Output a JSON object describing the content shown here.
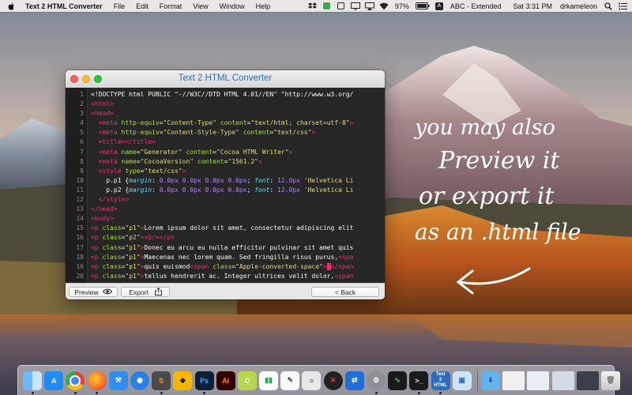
{
  "menubar": {
    "app_name": "Text 2 HTML Converter",
    "menus": [
      "File",
      "Edit",
      "Format",
      "View",
      "Window",
      "Help"
    ],
    "battery": "97%",
    "keyboard_layout": "ABC - Extended",
    "clock": "Sat 3:31 PM",
    "user": "drkameleon",
    "icons": [
      "apple-icon",
      "dropbox-icon",
      "green-status-icon",
      "box-icon",
      "display-icon",
      "airplay-icon",
      "wifi-icon",
      "battery-icon",
      "keyboard-icon",
      "search-icon",
      "notification-center-icon"
    ]
  },
  "window": {
    "title": "Text 2 HTML Converter",
    "line_numbers": [
      "1",
      "2",
      "3",
      "4",
      "5",
      "6",
      "7",
      "8",
      "9",
      "10",
      "11",
      "12",
      "13",
      "14",
      "15",
      "16",
      "17",
      "18",
      "19",
      "20"
    ],
    "code_lines": [
      [
        [
          "t-txt",
          "<!DOCTYPE html PUBLIC \"-//W3C//DTD HTML 4.01//EN\" \"http://www.w3.org/"
        ]
      ],
      [
        [
          "t-tag",
          "<html>"
        ]
      ],
      [
        [
          "t-tag",
          "<head>"
        ]
      ],
      [
        [
          "t-txt",
          "  "
        ],
        [
          "t-tag",
          "<meta "
        ],
        [
          "t-att",
          "http-equiv"
        ],
        [
          "t-txt",
          "="
        ],
        [
          "t-str",
          "\"Content-Type\""
        ],
        [
          "t-txt",
          " "
        ],
        [
          "t-att",
          "content"
        ],
        [
          "t-txt",
          "="
        ],
        [
          "t-str",
          "\"text/html; charset=utf-8\""
        ],
        [
          "t-tag",
          ">"
        ]
      ],
      [
        [
          "t-txt",
          "  "
        ],
        [
          "t-tag",
          "<meta "
        ],
        [
          "t-att",
          "http-equiv"
        ],
        [
          "t-txt",
          "="
        ],
        [
          "t-str",
          "\"Content-Style-Type\""
        ],
        [
          "t-txt",
          " "
        ],
        [
          "t-att",
          "content"
        ],
        [
          "t-txt",
          "="
        ],
        [
          "t-str",
          "\"text/css\""
        ],
        [
          "t-tag",
          ">"
        ]
      ],
      [
        [
          "t-txt",
          "  "
        ],
        [
          "t-tag",
          "<title></title>"
        ]
      ],
      [
        [
          "t-txt",
          "  "
        ],
        [
          "t-tag",
          "<meta "
        ],
        [
          "t-att",
          "name"
        ],
        [
          "t-txt",
          "="
        ],
        [
          "t-str",
          "\"Generator\""
        ],
        [
          "t-txt",
          " "
        ],
        [
          "t-att",
          "content"
        ],
        [
          "t-txt",
          "="
        ],
        [
          "t-str",
          "\"Cocoa HTML Writer\""
        ],
        [
          "t-tag",
          ">"
        ]
      ],
      [
        [
          "t-txt",
          "  "
        ],
        [
          "t-tag",
          "<meta "
        ],
        [
          "t-att",
          "name"
        ],
        [
          "t-txt",
          "="
        ],
        [
          "t-str",
          "\"CocoaVersion\""
        ],
        [
          "t-txt",
          " "
        ],
        [
          "t-att",
          "content"
        ],
        [
          "t-txt",
          "="
        ],
        [
          "t-str",
          "\"1561.2\""
        ],
        [
          "t-tag",
          ">"
        ]
      ],
      [
        [
          "t-txt",
          "  "
        ],
        [
          "t-tag",
          "<style "
        ],
        [
          "t-att",
          "type"
        ],
        [
          "t-txt",
          "="
        ],
        [
          "t-str",
          "\"text/css\""
        ],
        [
          "t-tag",
          ">"
        ]
      ],
      [
        [
          "t-txt",
          "    p.p1 {"
        ],
        [
          "t-key",
          "margin"
        ],
        [
          "t-txt",
          ": "
        ],
        [
          "t-num",
          "0.0px 0.0px 0.0px 0.0px"
        ],
        [
          "t-txt",
          "; "
        ],
        [
          "t-key",
          "font"
        ],
        [
          "t-txt",
          ": "
        ],
        [
          "t-num",
          "12.0px"
        ],
        [
          "t-str",
          " 'Helvetica Li"
        ]
      ],
      [
        [
          "t-txt",
          "    p.p2 {"
        ],
        [
          "t-key",
          "margin"
        ],
        [
          "t-txt",
          ": "
        ],
        [
          "t-num",
          "0.0px 0.0px 0.0px 0.0px"
        ],
        [
          "t-txt",
          "; "
        ],
        [
          "t-key",
          "font"
        ],
        [
          "t-txt",
          ": "
        ],
        [
          "t-num",
          "12.0px"
        ],
        [
          "t-str",
          " 'Helvetica Li"
        ]
      ],
      [
        [
          "t-txt",
          "  "
        ],
        [
          "t-tag",
          "</style>"
        ]
      ],
      [
        [
          "t-tag",
          "</head>"
        ]
      ],
      [
        [
          "t-tag",
          "<body>"
        ]
      ],
      [
        [
          "t-tag",
          "<p "
        ],
        [
          "t-att",
          "class"
        ],
        [
          "t-txt",
          "="
        ],
        [
          "t-str",
          "\"p1\""
        ],
        [
          "t-tag",
          ">"
        ],
        [
          "t-txt",
          "Lorem ipsum dolor sit amet, consectetur adipiscing elit"
        ]
      ],
      [
        [
          "t-tag",
          "<p "
        ],
        [
          "t-att",
          "class"
        ],
        [
          "t-txt",
          "="
        ],
        [
          "t-str",
          "\"p2\""
        ],
        [
          "t-tag",
          "><br></p>"
        ]
      ],
      [
        [
          "t-tag",
          "<p "
        ],
        [
          "t-att",
          "class"
        ],
        [
          "t-txt",
          "="
        ],
        [
          "t-str",
          "\"p1\""
        ],
        [
          "t-tag",
          ">"
        ],
        [
          "t-txt",
          "Donec eu arcu eu nulla efficitur pulvinar sit amet quis"
        ]
      ],
      [
        [
          "t-tag",
          "<p "
        ],
        [
          "t-att",
          "class"
        ],
        [
          "t-txt",
          "="
        ],
        [
          "t-str",
          "\"p1\""
        ],
        [
          "t-tag",
          ">"
        ],
        [
          "t-txt",
          "Maecenas nec lorem quam. Sed fringilla risus purus,"
        ],
        [
          "t-tag",
          "<spa"
        ]
      ],
      [
        [
          "t-tag",
          "<p "
        ],
        [
          "t-att",
          "class"
        ],
        [
          "t-txt",
          "="
        ],
        [
          "t-str",
          "\"p1\""
        ],
        [
          "t-tag",
          ">"
        ],
        [
          "t-txt",
          "quis euismod"
        ],
        [
          "t-tag",
          "<span "
        ],
        [
          "t-att",
          "class"
        ],
        [
          "t-txt",
          "="
        ],
        [
          "t-str",
          "\"Apple-converted-space\""
        ],
        [
          "t-tag",
          ">"
        ],
        [
          "t-cur",
          " "
        ],
        [
          "t-tag",
          "</span"
        ]
      ],
      [
        [
          "t-tag",
          "<p "
        ],
        [
          "t-att",
          "class"
        ],
        [
          "t-txt",
          "="
        ],
        [
          "t-str",
          "\"p1\""
        ],
        [
          "t-tag",
          ">"
        ],
        [
          "t-txt",
          "tellus hendrerit ac. Integer ultrices velit dolor,"
        ],
        [
          "t-tag",
          "<span"
        ]
      ]
    ],
    "toolbar": {
      "preview_label": "Preview",
      "export_label": "Export",
      "back_label": "< Back"
    }
  },
  "annotation": {
    "lines": [
      "you may also",
      "Preview it",
      "or export it",
      "as an .html file"
    ]
  },
  "dock": {
    "apps": [
      "Finder",
      "App Store",
      "Chrome",
      "Firefox",
      "Xcode",
      "Maps",
      "Sublime Text",
      "Sketch",
      "Photoshop",
      "Illustrator",
      "Coda",
      "Numbers",
      "TextEdit",
      "Preferences",
      "Safari",
      "Tower",
      "System Preferences",
      "Activity Monitor",
      "Terminal",
      "Text 2 HTML",
      "Preview",
      "Downloads",
      "Window",
      "Screen",
      "Trash"
    ]
  }
}
